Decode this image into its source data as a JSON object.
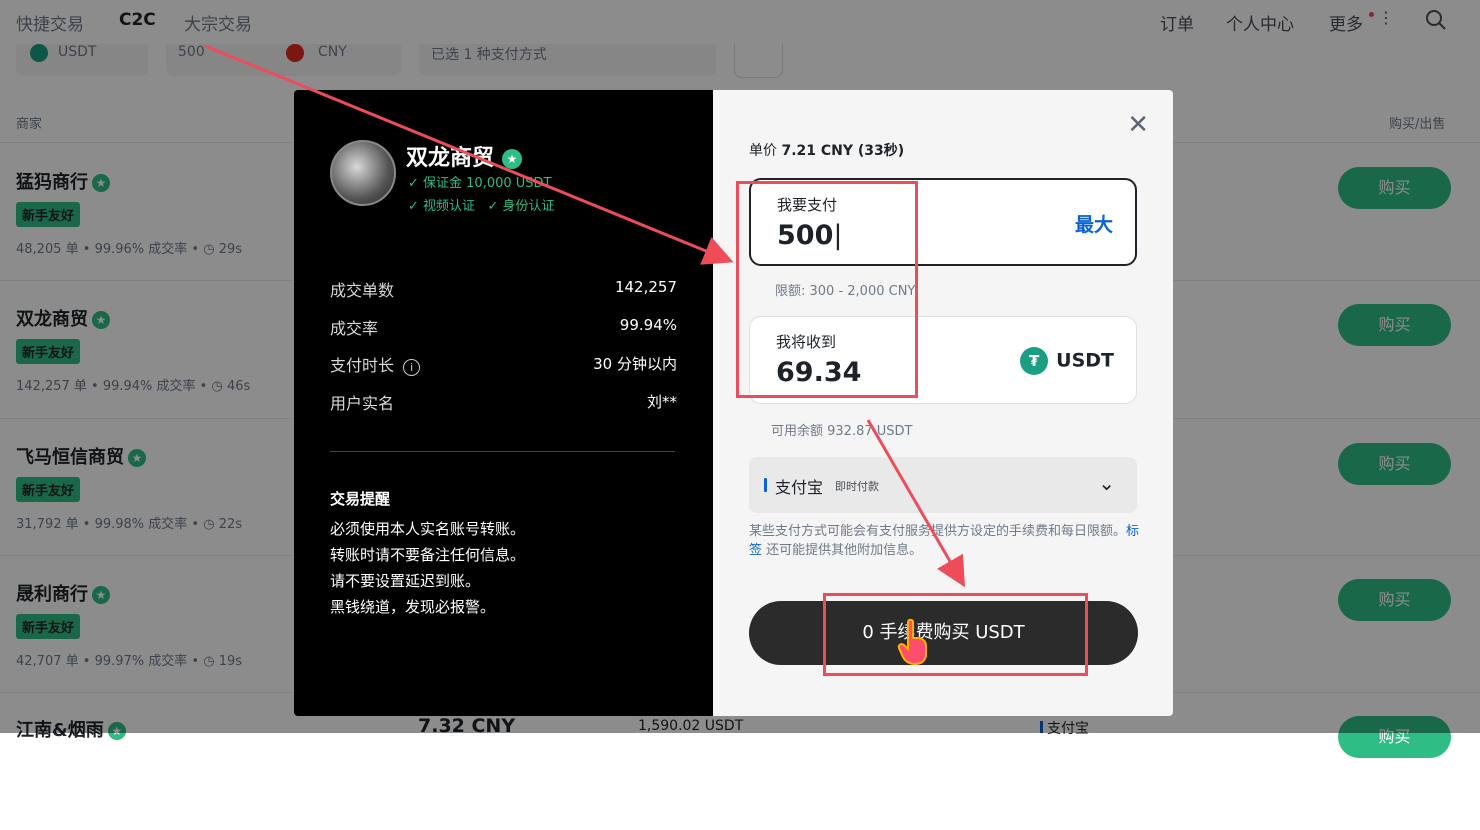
{
  "topnav": {
    "left": [
      "快捷交易",
      "C2C",
      "大宗交易"
    ],
    "right": [
      "订单",
      "个人中心",
      "更多"
    ]
  },
  "filters": {
    "crypto": "USDT",
    "amount": "500",
    "fiat": "CNY",
    "payment": "已选 1 种支付方式"
  },
  "columns": {
    "merchant": "商家",
    "action": "购买/出售"
  },
  "merchants": [
    {
      "name": "猛犸商行",
      "badge": "新手友好",
      "orders": "48,205 单",
      "rate": "99.96% 成交率",
      "time": "29s",
      "action": "购买"
    },
    {
      "name": "双龙商贸",
      "badge": "新手友好",
      "orders": "142,257 单",
      "rate": "99.94% 成交率",
      "time": "46s",
      "action": "购买"
    },
    {
      "name": "飞马恒信商贸",
      "badge": "新手友好",
      "orders": "31,792 单",
      "rate": "99.98% 成交率",
      "time": "22s",
      "action": "购买"
    },
    {
      "name": "晟利商行",
      "badge": "新手友好",
      "orders": "42,707 单",
      "rate": "99.97% 成交率",
      "time": "19s",
      "action": "购买"
    },
    {
      "name": "江南&烟雨",
      "price": "7.32 CNY",
      "available": "1,590.02 USDT",
      "payment": "支付宝",
      "action": "购买"
    }
  ],
  "modal": {
    "merchant": {
      "name": "双龙商贸",
      "deposit": "保证金 10,000 USDT",
      "video_verify": "视频认证",
      "id_verify": "身份认证"
    },
    "stats": [
      {
        "label": "成交单数",
        "value": "142,257"
      },
      {
        "label": "成交率",
        "value": "99.94%"
      },
      {
        "label": "支付时长",
        "value": "30 分钟以内"
      },
      {
        "label": "用户实名",
        "value": "刘**"
      }
    ],
    "tips": {
      "title": "交易提醒",
      "lines": [
        "必须使用本人实名账号转账。",
        "转账时请不要备注任何信息。",
        "请不要设置延迟到账。",
        "黑钱绕道，发现必报警。"
      ]
    },
    "price_label": "单价",
    "price_value": "7.21 CNY (33秒)",
    "pay": {
      "label": "我要支付",
      "value": "500",
      "max": "最大",
      "limit": "限额: 300 - 2,000 CNY"
    },
    "receive": {
      "label": "我将收到",
      "value": "69.34",
      "currency": "USDT",
      "balance": "可用余额 932.87 USDT"
    },
    "payment_method": {
      "name": "支付宝",
      "sub": "即时付款"
    },
    "note_a": "某些支付方式可能会有支付服务提供方设定的手续费和每日限额。",
    "note_link": "标签",
    "note_b": " 还可能提供其他附加信息。",
    "buy_button": "0 手续费购买 USDT"
  },
  "colors": {
    "green": "#2ebd85",
    "annotation_red": "#ef4c5a",
    "link_blue": "#0b62d6"
  }
}
